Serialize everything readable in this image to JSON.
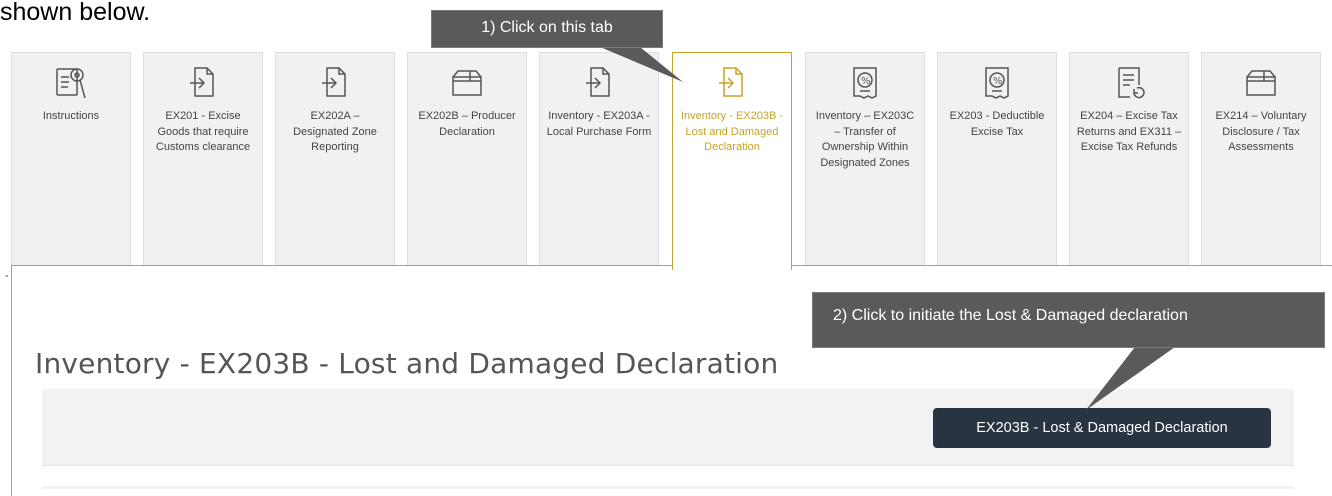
{
  "intro_text": "shown below.",
  "tabs": [
    {
      "label": "Instructions",
      "icon": "document-search-icon"
    },
    {
      "label": "EX201 - Excise Goods that require Customs clearance",
      "icon": "import-arrow-icon"
    },
    {
      "label": "EX202A – Designated Zone Reporting",
      "icon": "import-arrow-icon"
    },
    {
      "label": "EX202B – Producer Declaration",
      "icon": "box-icon"
    },
    {
      "label": "Inventory - EX203A - Local Purchase Form",
      "icon": "import-arrow-icon"
    },
    {
      "label": "Inventory - EX203B - Lost and Damaged Declaration",
      "icon": "import-arrow-icon",
      "active": true
    },
    {
      "label": "Inventory – EX203C – Transfer of Ownership Within Designated Zones",
      "icon": "percent-document-icon"
    },
    {
      "label": "EX203 - Deductible Excise Tax",
      "icon": "percent-document-icon"
    },
    {
      "label": "EX204 – Excise Tax Returns and EX311 – Excise Tax Refunds",
      "icon": "refund-document-icon"
    },
    {
      "label": "EX214 – Voluntary Disclosure / Tax Assessments",
      "icon": "box-icon"
    }
  ],
  "panel_marker": "-",
  "page_title": "Inventory - EX203B - Lost and Damaged Declaration",
  "action_button": "EX203B - Lost & Damaged Declaration",
  "callouts": {
    "step1": "1) Click on this tab",
    "step2": "2) Click to initiate the Lost & Damaged declaration"
  },
  "colors": {
    "active_accent": "#c9a227",
    "button_bg": "#293443",
    "callout_bg": "#5a5a5a",
    "tab_bg": "#f1f1f1"
  }
}
